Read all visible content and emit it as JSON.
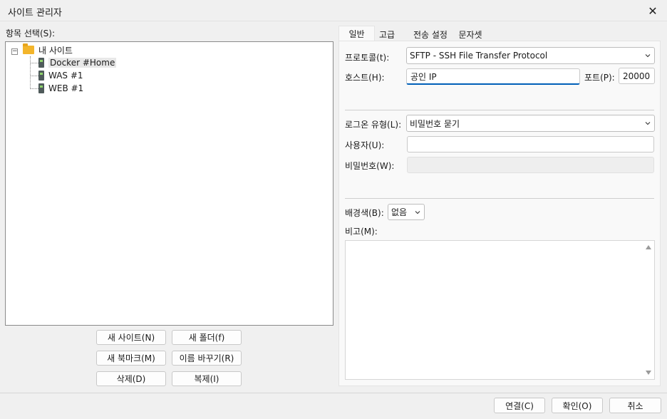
{
  "window": {
    "title": "사이트 관리자"
  },
  "left": {
    "section_label": "항목 선택(S):",
    "tree": {
      "root": "내 사이트",
      "items": [
        "Docker #Home",
        "WAS #1",
        "WEB #1"
      ]
    },
    "buttons": {
      "new_site": "새 사이트(N)",
      "new_folder": "새 폴더(f)",
      "new_bookmark": "새 북마크(M)",
      "rename": "이름 바꾸기(R)",
      "delete": "삭제(D)",
      "duplicate": "복제(I)"
    }
  },
  "tabs": [
    "일반",
    "고급",
    "전송 설정",
    "문자셋"
  ],
  "general": {
    "protocol_label": "프로토콜(t):",
    "protocol_value": "SFTP - SSH File Transfer Protocol",
    "host_label": "호스트(H):",
    "host_value": "공인 IP",
    "port_label": "포트(P):",
    "port_value": "20000",
    "logon_type_label": "로그온 유형(L):",
    "logon_type_value": "비밀번호 묻기",
    "user_label": "사용자(U):",
    "user_value": "",
    "password_label": "비밀번호(W):",
    "password_value": "",
    "bg_color_label": "배경색(B):",
    "bg_color_value": "없음",
    "comments_label": "비고(M):",
    "comments_value": ""
  },
  "footer": {
    "connect": "연결(C)",
    "ok": "확인(O)",
    "cancel": "취소"
  },
  "colors": {
    "accent": "#005fb8",
    "folder": "#f3b52b"
  }
}
